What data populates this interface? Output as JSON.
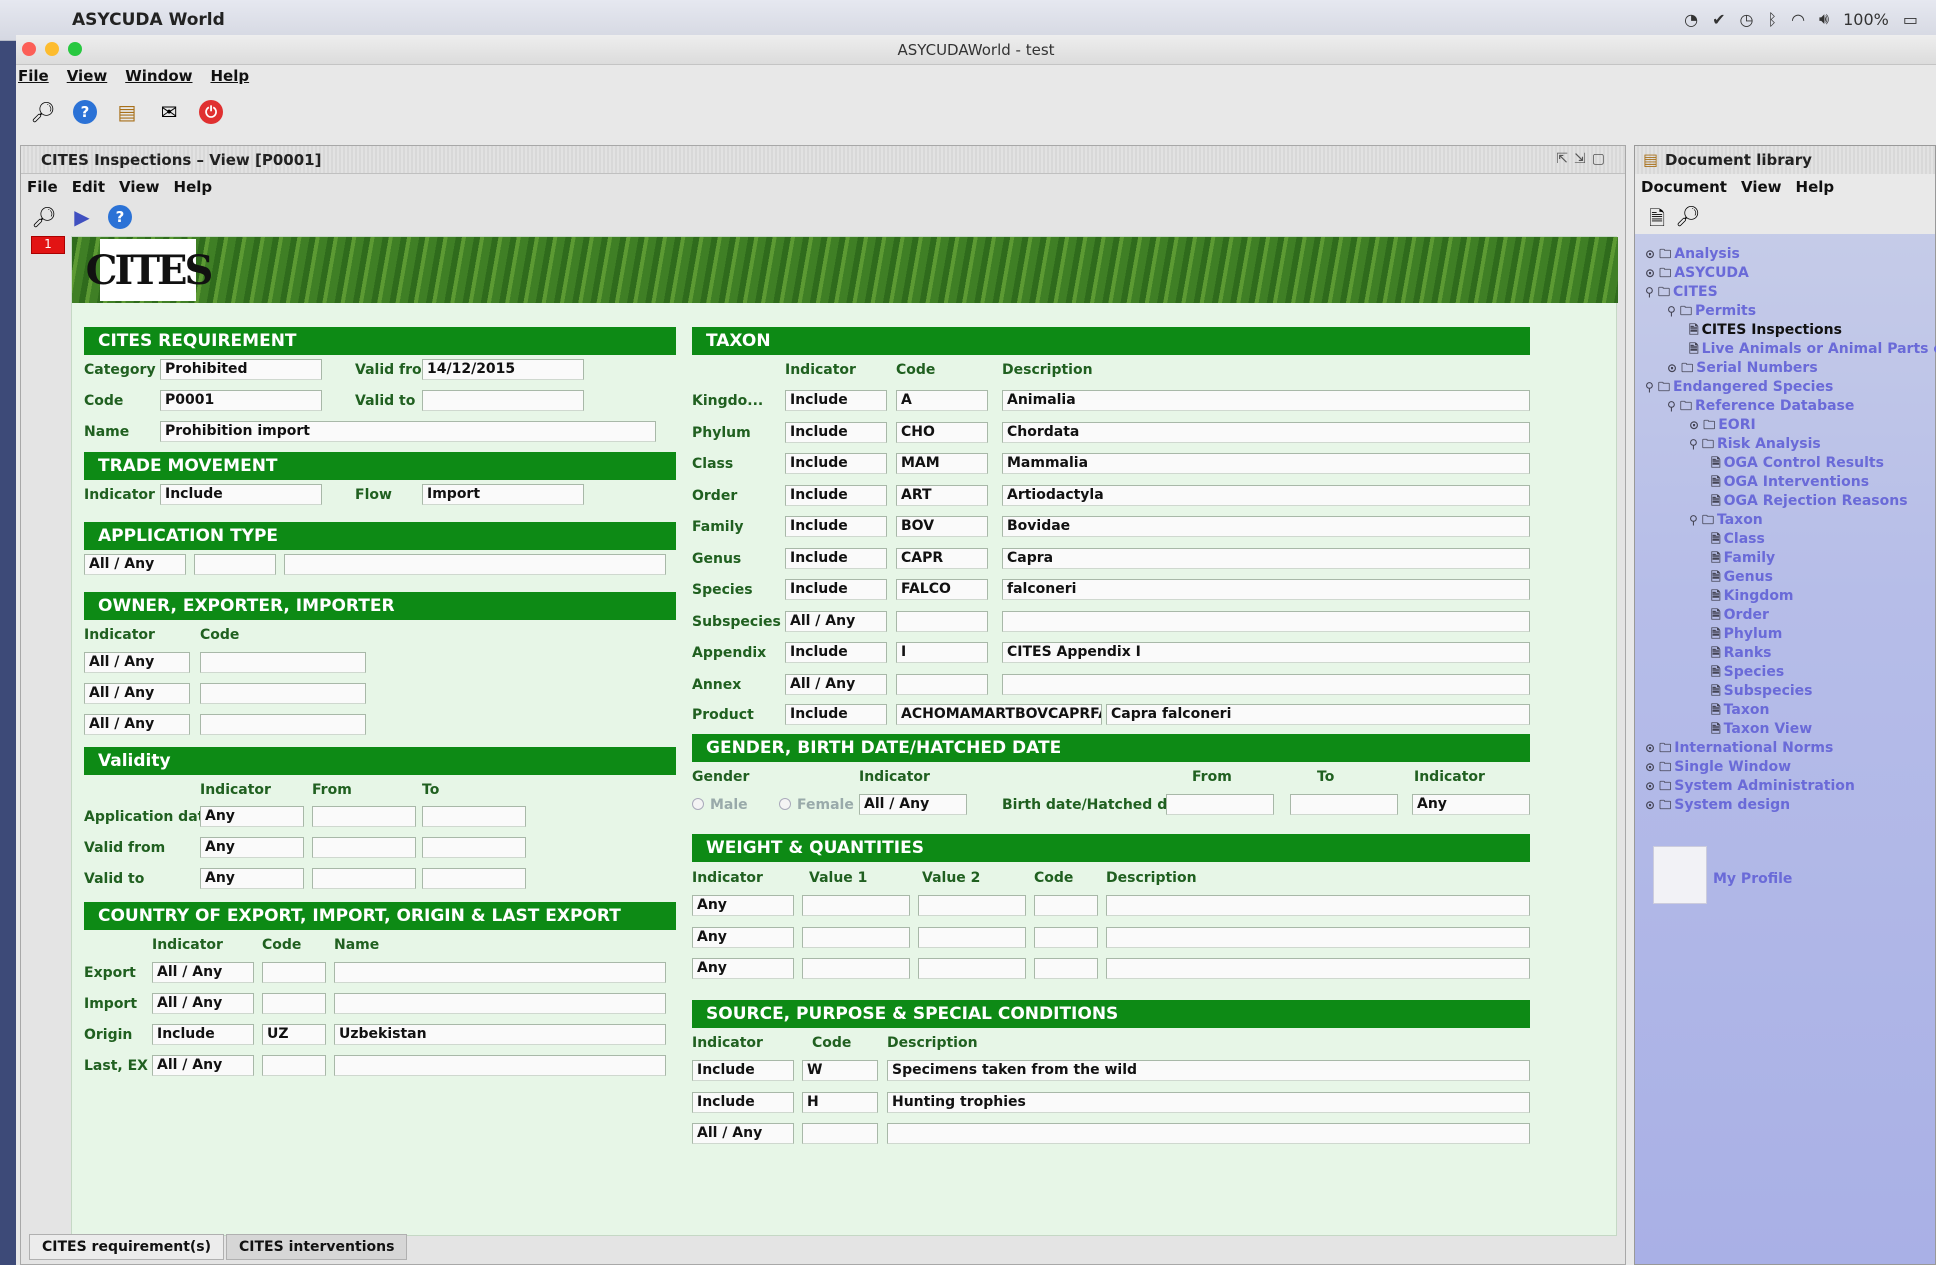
{
  "os": {
    "app_name": "ASYCUDA World",
    "battery": "100%"
  },
  "window": {
    "title": "ASYCUDAWorld - test",
    "menu": [
      "File",
      "View",
      "Window",
      "Help"
    ]
  },
  "inner": {
    "title": "CITES Inspections – View [P0001]",
    "menu": [
      "File",
      "Edit",
      "View",
      "Help"
    ],
    "badge": "1",
    "logo": "CITES",
    "bottom_tabs": [
      "CITES requirement(s)",
      "CITES interventions"
    ]
  },
  "req": {
    "header": "CITES REQUIREMENT",
    "category_label": "Category",
    "category": "Prohibited",
    "valid_from_label": "Valid from",
    "valid_from": "14/12/2015",
    "code_label": "Code",
    "code": "P0001",
    "valid_to_label": "Valid to",
    "valid_to": "",
    "name_label": "Name",
    "name": "Prohibition import"
  },
  "trade": {
    "header": "TRADE MOVEMENT",
    "indicator_label": "Indicator",
    "indicator": "Include",
    "flow_label": "Flow",
    "flow": "Import"
  },
  "app_type": {
    "header": "APPLICATION TYPE",
    "value": "All / Any"
  },
  "owner": {
    "header": "OWNER, EXPORTER, IMPORTER",
    "col_indicator": "Indicator",
    "col_code": "Code",
    "rows": [
      "All / Any",
      "All / Any",
      "All / Any"
    ]
  },
  "validity": {
    "header": "Validity",
    "col_indicator": "Indicator",
    "col_from": "From",
    "col_to": "To",
    "rows": [
      {
        "label": "Application date",
        "value": "Any"
      },
      {
        "label": "Valid from",
        "value": "Any"
      },
      {
        "label": "Valid to",
        "value": "Any"
      }
    ]
  },
  "country": {
    "header": "COUNTRY OF EXPORT, IMPORT, ORIGIN & LAST EXPORT",
    "col_indicator": "Indicator",
    "col_code": "Code",
    "col_name": "Name",
    "rows": [
      {
        "label": "Export",
        "indicator": "All / Any",
        "code": "",
        "name": ""
      },
      {
        "label": "Import",
        "indicator": "All / Any",
        "code": "",
        "name": ""
      },
      {
        "label": "Origin",
        "indicator": "Include",
        "code": "UZ",
        "name": "Uzbekistan"
      },
      {
        "label": "Last, EX",
        "indicator": "All / Any",
        "code": "",
        "name": ""
      }
    ]
  },
  "taxon": {
    "header": "TAXON",
    "col_indicator": "Indicator",
    "col_code": "Code",
    "col_desc": "Description",
    "rows": [
      {
        "label": "Kingdo...",
        "indicator": "Include",
        "code": "A",
        "desc": "Animalia"
      },
      {
        "label": "Phylum",
        "indicator": "Include",
        "code": "CHO",
        "desc": "Chordata"
      },
      {
        "label": "Class",
        "indicator": "Include",
        "code": "MAM",
        "desc": "Mammalia"
      },
      {
        "label": "Order",
        "indicator": "Include",
        "code": "ART",
        "desc": "Artiodactyla"
      },
      {
        "label": "Family",
        "indicator": "Include",
        "code": "BOV",
        "desc": "Bovidae"
      },
      {
        "label": "Genus",
        "indicator": "Include",
        "code": "CAPR",
        "desc": "Capra"
      },
      {
        "label": "Species",
        "indicator": "Include",
        "code": "FALCO",
        "desc": "falconeri"
      },
      {
        "label": "Subspecies",
        "indicator": "All / Any",
        "code": "",
        "desc": ""
      },
      {
        "label": "Appendix",
        "indicator": "Include",
        "code": "I",
        "desc": "CITES Appendix I"
      },
      {
        "label": "Annex",
        "indicator": "All / Any",
        "code": "",
        "desc": ""
      }
    ],
    "product_label": "Product",
    "product_indicator": "Include",
    "product_code": "ACHOMAMARTBOVCAPRFALC",
    "product_desc": "Capra falconeri"
  },
  "gender": {
    "header": "GENDER, BIRTH DATE/HATCHED DATE",
    "gender_label": "Gender",
    "indicator_label": "Indicator",
    "from_label": "From",
    "to_label": "To",
    "indicator2_label": "Indicator",
    "male": "Male",
    "female": "Female",
    "indicator": "All / Any",
    "birth_label": "Birth date/Hatched date",
    "indicator2": "Any"
  },
  "weight": {
    "header": "WEIGHT & QUANTITIES",
    "col_indicator": "Indicator",
    "col_v1": "Value 1",
    "col_v2": "Value 2",
    "col_code": "Code",
    "col_desc": "Description",
    "rows": [
      "Any",
      "Any",
      "Any"
    ]
  },
  "source": {
    "header": "SOURCE, PURPOSE & SPECIAL CONDITIONS",
    "col_indicator": "Indicator",
    "col_code": "Code",
    "col_desc": "Description",
    "rows": [
      {
        "indicator": "Include",
        "code": "W",
        "desc": "Specimens taken from the wild"
      },
      {
        "indicator": "Include",
        "code": "H",
        "desc": "Hunting trophies"
      },
      {
        "indicator": "All / Any",
        "code": "",
        "desc": ""
      }
    ]
  },
  "library": {
    "title": "Document library",
    "menu": [
      "Document",
      "View",
      "Help"
    ],
    "tree": [
      "Analysis",
      "ASYCUDA",
      "CITES",
      "Permits",
      "CITES Inspections",
      "Live Animals or Animal Parts or",
      "Serial Numbers",
      "Endangered Species",
      "Reference Database",
      "EORI",
      "Risk Analysis",
      "OGA Control Results",
      "OGA Interventions",
      "OGA Rejection Reasons",
      "Taxon",
      "Class",
      "Family",
      "Genus",
      "Kingdom",
      "Order",
      "Phylum",
      "Ranks",
      "Species",
      "Subspecies",
      "Taxon",
      "Taxon View",
      "International Norms",
      "Single Window",
      "System Administration",
      "System design"
    ],
    "profile": "My Profile"
  }
}
